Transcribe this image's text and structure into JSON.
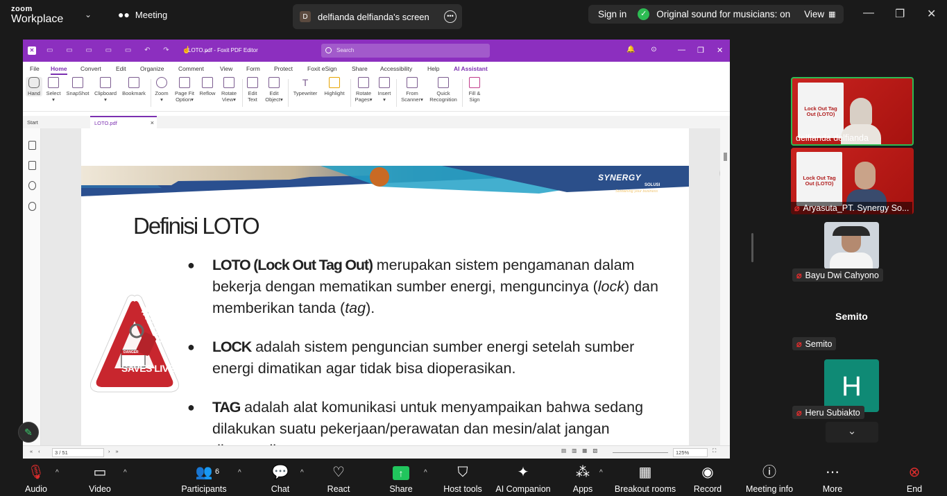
{
  "topbar": {
    "brand_top": "zoom",
    "brand_bottom": "Workplace",
    "meeting_label": "Meeting",
    "share_badge": "D",
    "share_title": "delfianda delfianda's screen",
    "sign_in": "Sign in",
    "sound_status": "Original sound for musicians: on",
    "view_label": "View"
  },
  "foxit": {
    "window_title": "LOTO.pdf - Foxit PDF Editor",
    "search_placeholder": "Search",
    "menu": [
      "File",
      "Home",
      "Convert",
      "Edit",
      "Organize",
      "Comment",
      "View",
      "Form",
      "Protect",
      "Foxit eSign",
      "Share",
      "Accessibility",
      "Help",
      "AI Assistant"
    ],
    "active_menu": "Home",
    "ribbon": [
      {
        "l1": "Hand",
        "l2": ""
      },
      {
        "l1": "Select",
        "l2": "▾"
      },
      {
        "l1": "SnapShot",
        "l2": ""
      },
      {
        "l1": "Clipboard",
        "l2": "▾"
      },
      {
        "l1": "Bookmark",
        "l2": ""
      },
      {
        "l1": "Zoom",
        "l2": "▾"
      },
      {
        "l1": "Page Fit",
        "l2": "Option▾"
      },
      {
        "l1": "Reflow",
        "l2": ""
      },
      {
        "l1": "Rotate",
        "l2": "View▾"
      },
      {
        "l1": "Edit",
        "l2": "Text"
      },
      {
        "l1": "Edit",
        "l2": "Object▾"
      },
      {
        "l1": "Typewriter",
        "l2": ""
      },
      {
        "l1": "Highlight",
        "l2": ""
      },
      {
        "l1": "Rotate",
        "l2": "Pages▾"
      },
      {
        "l1": "Insert",
        "l2": "▾"
      },
      {
        "l1": "From",
        "l2": "Scanner▾"
      },
      {
        "l1": "Quick",
        "l2": "Recognition"
      },
      {
        "l1": "Fill &",
        "l2": "Sign"
      }
    ],
    "tabs": {
      "start": "Start",
      "doc": "LOTO.pdf"
    },
    "page_indicator": "3 / 51",
    "zoom_level": "125%"
  },
  "slide": {
    "brand": "SYNERGY",
    "brand_sub": "SOLUSI",
    "brand_tagline": "Sustaining your business",
    "title": "Definisi LOTO",
    "sign_top_left": "LOCK-OUT",
    "sign_top_right": "TAG-OUT",
    "sign_bottom": "SAVES LIVES",
    "sign_tag": "DANGER",
    "bullets": [
      {
        "bold": "LOTO (Lock Out Tag Out)",
        "text": " merupakan sistem pengamanan dalam bekerja dengan mematikan sumber energi, menguncinya (",
        "ital1": "lock",
        "text2": ") dan memberikan tanda (",
        "ital2": "tag",
        "text3": ")."
      },
      {
        "bold": "LOCK",
        "text": " adalah sistem penguncian sumber energi setelah sumber energi dimatikan agar tidak bisa dioperasikan."
      },
      {
        "bold": "TAG",
        "text": " adalah alat komunikasi untuk menyampaikan bahwa sedang dilakukan suatu pekerjaan/perawatan dan mesin/alat jangan dioperasikan."
      }
    ]
  },
  "participants": [
    {
      "name": "delfianda delfianda",
      "muted": false,
      "slide_text": "Lock Out Tag Out (LOTO)"
    },
    {
      "name": "Aryasuta_PT. Synergy So...",
      "muted": true,
      "slide_text": "Lock Out Tag Out (LOTO)"
    },
    {
      "name": "Bayu Dwi Cahyono",
      "muted": true
    },
    {
      "name": "Semito",
      "muted": true,
      "big_name": "Semito"
    },
    {
      "name": "Heru Subiakto",
      "muted": true,
      "initial": "H"
    }
  ],
  "toolbar": {
    "audio": "Audio",
    "video": "Video",
    "participants": "Participants",
    "participant_count": "6",
    "chat": "Chat",
    "react": "React",
    "share": "Share",
    "host_tools": "Host tools",
    "ai_companion": "AI Companion",
    "apps": "Apps",
    "breakout_rooms": "Breakout rooms",
    "record": "Record",
    "meeting_info": "Meeting info",
    "more": "More",
    "end": "End"
  },
  "colors": {
    "foxit_purple": "#8c2fbf",
    "zoom_green": "#2dbb53",
    "end_red": "#e02d2d",
    "share_green": "#21c55d"
  }
}
